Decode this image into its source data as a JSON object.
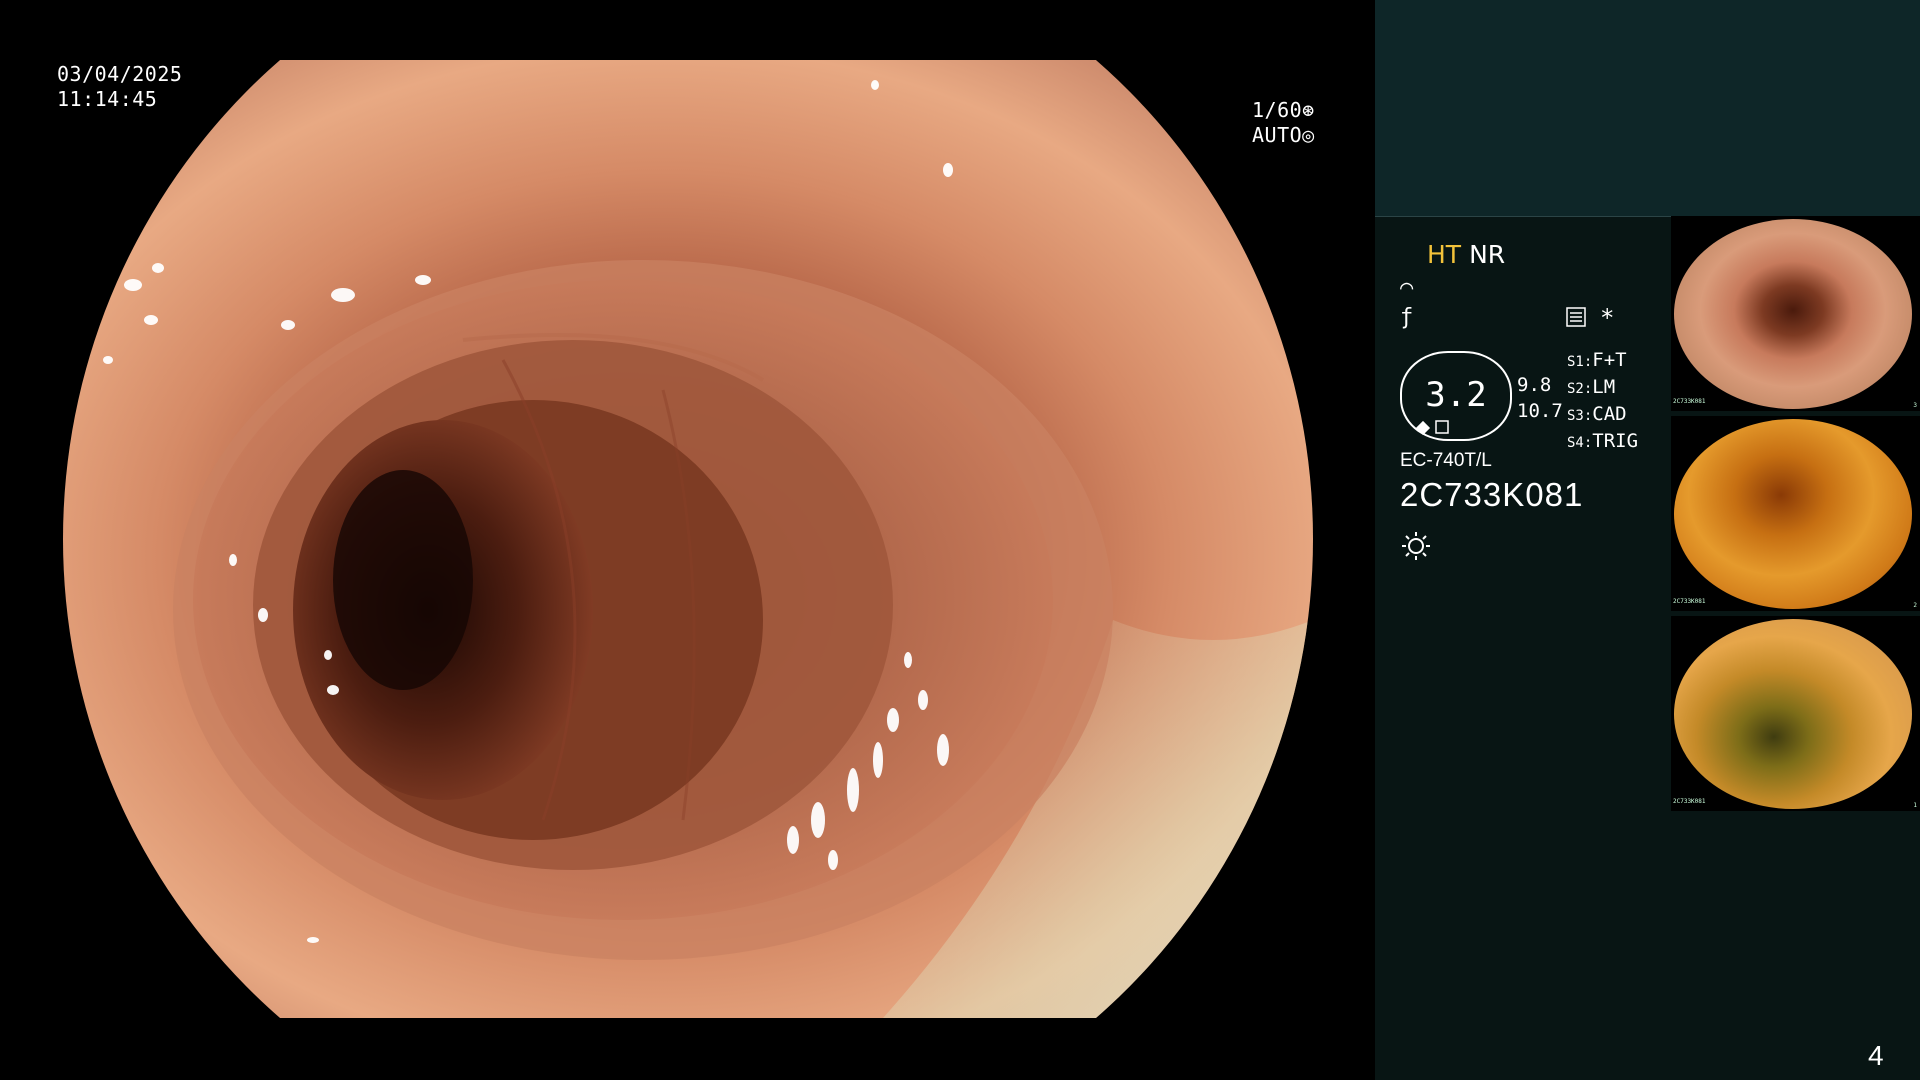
{
  "overlay": {
    "date": "03/04/2025",
    "time": "11:14:45",
    "shutter": "1/60",
    "iris_mode": "AUTO"
  },
  "panel": {
    "mode_primary": "HT",
    "mode_secondary": "NR",
    "zoom_value": "3.2",
    "zoom_side_top": "9.8",
    "zoom_side_bottom": "10.7",
    "asterisk": "*",
    "switches": [
      {
        "key": "S1:",
        "value": "F+T"
      },
      {
        "key": "S2:",
        "value": "LM"
      },
      {
        "key": "S3:",
        "value": "CAD"
      },
      {
        "key": "S4:",
        "value": "TRIG"
      }
    ],
    "scope_model": "EC-740T/L",
    "scope_serial": "2C733K081"
  },
  "thumbnails": [
    {
      "serial": "2C733K081",
      "index": "3"
    },
    {
      "serial": "2C733K081",
      "index": "2"
    },
    {
      "serial": "2C733K081",
      "index": "1"
    }
  ],
  "page_number": "4",
  "colors": {
    "background": "#000000",
    "panel": "#081514",
    "panel_header": "#0e2628",
    "accent_yellow": "#f2c23a"
  },
  "icons": [
    "shutter-icon",
    "iris-icon",
    "curve-icon",
    "function-icon",
    "settings-icon",
    "light-icon"
  ]
}
